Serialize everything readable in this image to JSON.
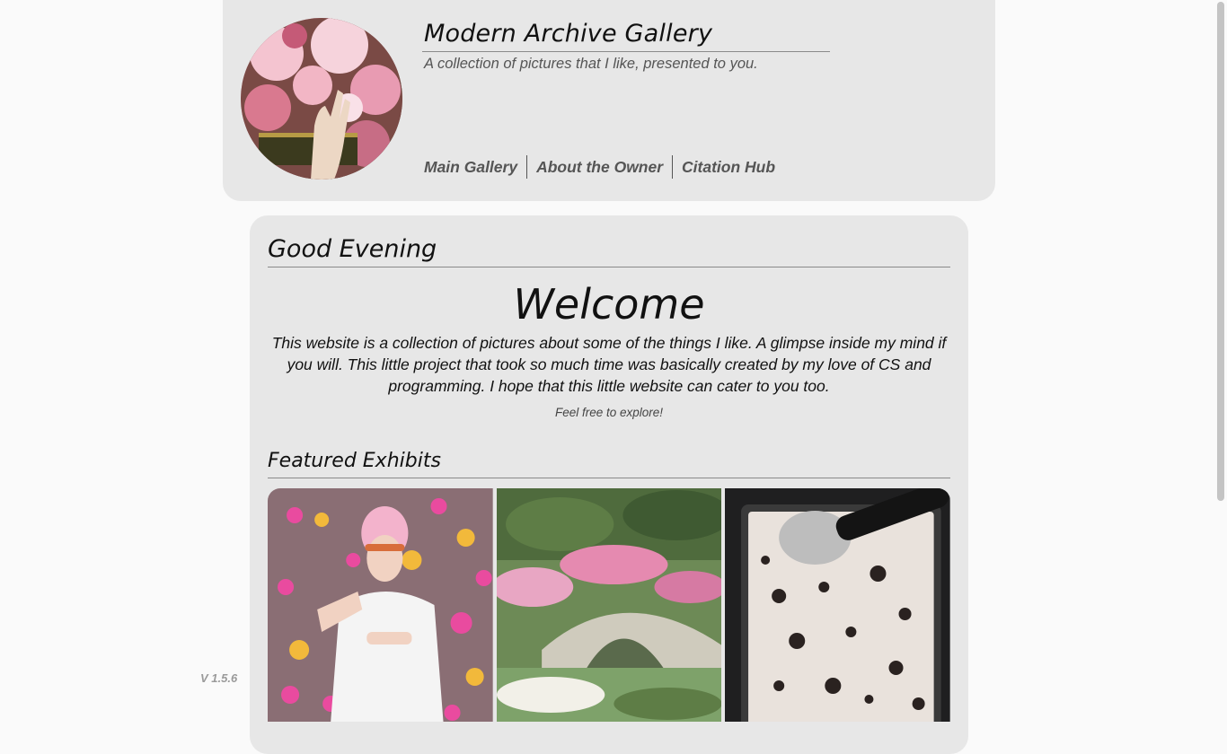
{
  "header": {
    "title": "Modern Archive Gallery",
    "subtitle": "A collection of pictures that I like, presented to you.",
    "avatar_icon": "flowers-hand-painting-icon",
    "nav": [
      {
        "label": "Main Gallery"
      },
      {
        "label": "About the Owner"
      },
      {
        "label": "Citation Hub"
      }
    ]
  },
  "main": {
    "greeting": "Good Evening",
    "welcome": "Welcome",
    "intro": "This website is a collection of pictures about some of the things I like. A glimpse inside my mind if you will. This little project that took so much time was basically created by my love of CS and programming. I hope that this little website can cater to you too.",
    "explore": "Feel free to explore!",
    "featured_title": "Featured Exhibits",
    "exhibits": [
      {
        "icon": "person-hearts-photo-icon"
      },
      {
        "icon": "garden-bridge-photo-icon"
      },
      {
        "icon": "cookies-cream-icecream-photo-icon"
      }
    ]
  },
  "footer": {
    "version": "V 1.5.6"
  },
  "colors": {
    "page_bg": "#fafafa",
    "panel_bg": "#e7e7e7",
    "nav_text": "#555555",
    "rule": "#8a8a8a"
  }
}
